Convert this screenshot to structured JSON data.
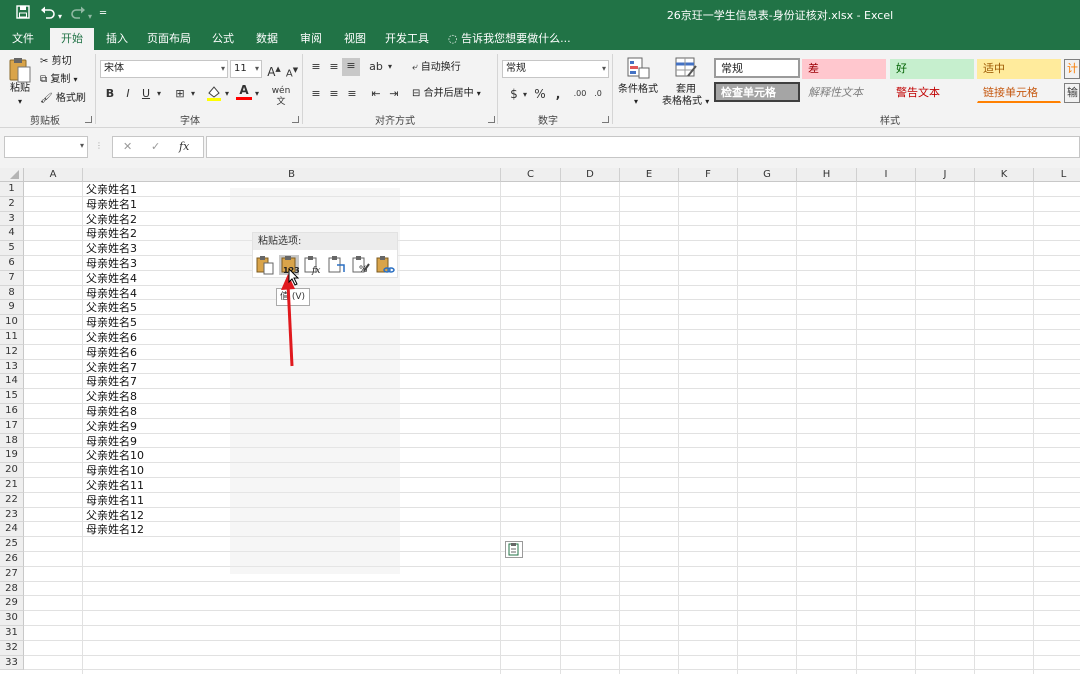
{
  "window": {
    "title": "26京玨一学生信息表-身份证核对.xlsx - Excel"
  },
  "quick_access": {
    "save_icon": "save-icon",
    "undo_icon": "undo-icon",
    "redo_icon": "redo-icon",
    "customize_icon": "customize-icon"
  },
  "tabs": [
    "文件",
    "开始",
    "插入",
    "页面布局",
    "公式",
    "数据",
    "审阅",
    "视图",
    "开发工具"
  ],
  "tell_me": {
    "icon": "lightbulb-icon",
    "placeholder": "告诉我您想要做什么..."
  },
  "ribbon": {
    "clipboard": {
      "paste": "粘贴",
      "cut": "剪切",
      "copy": "复制",
      "format_painter": "格式刷",
      "label": "剪贴板"
    },
    "font": {
      "font_name": "宋体",
      "font_size": "11",
      "grow": "A",
      "shrink": "A",
      "bold": "B",
      "italic": "I",
      "underline": "U",
      "font_color_glyph": "A",
      "phonetic": "wén",
      "label": "字体"
    },
    "alignment": {
      "wrap_text": "自动换行",
      "merge_center": "合并后居中",
      "label": "对齐方式"
    },
    "number": {
      "format": "常规",
      "currency": "$",
      "percent": "%",
      "comma": ",",
      "label": "数字"
    },
    "styles": {
      "conditional_format": "条件格式",
      "table_format_line1": "套用",
      "table_format_line2": "表格格式",
      "cells": [
        "常规",
        "差",
        "好",
        "适中",
        "计",
        "检查单元格",
        "解释性文本",
        "警告文本",
        "链接单元格",
        "输"
      ],
      "label": "样式"
    }
  },
  "formula_bar": {
    "cancel": "✕",
    "enter": "✓",
    "fx": "fx",
    "value": ""
  },
  "columns": [
    "A",
    "B",
    "C",
    "D",
    "E",
    "F",
    "G",
    "H",
    "I",
    "J",
    "K",
    "L"
  ],
  "rows": [
    "1",
    "2",
    "3",
    "4",
    "5",
    "6",
    "7",
    "8",
    "9",
    "10",
    "11",
    "12",
    "13",
    "14",
    "15",
    "16",
    "17",
    "18",
    "19",
    "20",
    "21",
    "22",
    "23",
    "24",
    "25",
    "26",
    "27",
    "28",
    "29",
    "30",
    "31",
    "32",
    "33"
  ],
  "cells_b": [
    "父亲姓名1",
    "母亲姓名1",
    "父亲姓名2",
    "母亲姓名2",
    "父亲姓名3",
    "母亲姓名3",
    "父亲姓名4",
    "母亲姓名4",
    "父亲姓名5",
    "母亲姓名5",
    "父亲姓名6",
    "母亲姓名6",
    "父亲姓名7",
    "母亲姓名7",
    "父亲姓名8",
    "母亲姓名8",
    "父亲姓名9",
    "母亲姓名9",
    "父亲姓名10",
    "母亲姓名10",
    "父亲姓名11",
    "母亲姓名11",
    "父亲姓名12",
    "母亲姓名12"
  ],
  "paste_options": {
    "title": "粘贴选项:",
    "icons": [
      "paste-icon",
      "paste-values-icon",
      "paste-formulas-icon",
      "paste-transpose-icon",
      "paste-formatting-icon",
      "paste-link-icon"
    ],
    "values_label": "123",
    "tooltip": "值 (V)"
  },
  "colors": {
    "accent": "#217346",
    "arrow": "#e0191e",
    "bad_fill": "#ffc7ce",
    "good_fill": "#c6efce",
    "neutral_fill": "#ffeb9c",
    "warning_text": "#c00000",
    "link_text": "#c65911"
  }
}
